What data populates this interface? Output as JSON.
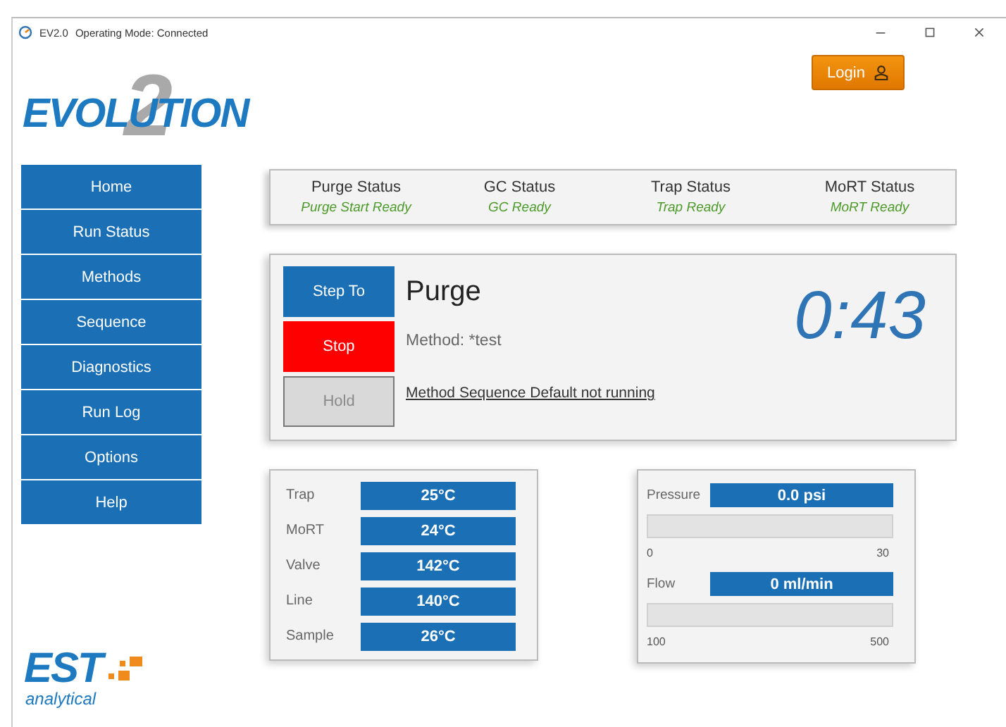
{
  "window": {
    "app": "EV2.0",
    "title": "Operating Mode: Connected"
  },
  "logo": {
    "word": "EVOLUTION",
    "numeral": "2"
  },
  "login": {
    "label": "Login"
  },
  "sidebar": {
    "items": [
      {
        "label": "Home",
        "selected": false
      },
      {
        "label": "Run Status",
        "selected": false
      },
      {
        "label": "Methods",
        "selected": false
      },
      {
        "label": "Sequence",
        "selected": false
      },
      {
        "label": "Diagnostics",
        "selected": false
      },
      {
        "label": "Run Log",
        "selected": false
      },
      {
        "label": "Options",
        "selected": false
      },
      {
        "label": "Help",
        "selected": false
      }
    ]
  },
  "statuses": [
    {
      "name": "Purge Status",
      "value": "Purge Start Ready"
    },
    {
      "name": "GC Status",
      "value": "GC Ready"
    },
    {
      "name": "Trap Status",
      "value": "Trap Ready"
    },
    {
      "name": "MoRT Status",
      "value": "MoRT Ready"
    }
  ],
  "run": {
    "buttons": [
      {
        "label": "Step To",
        "kind": "primary",
        "disabled": false
      },
      {
        "label": "Stop",
        "kind": "danger",
        "disabled": false
      },
      {
        "label": "Hold",
        "kind": "neutral",
        "disabled": true
      }
    ],
    "step": "Purge",
    "method": "Method: *test",
    "sequence_link": "Method Sequence Default not running",
    "timer": "0:43"
  },
  "temperatures": [
    {
      "name": "Trap",
      "value": "25°C"
    },
    {
      "name": "MoRT",
      "value": "24°C"
    },
    {
      "name": "Valve",
      "value": "142°C"
    },
    {
      "name": "Line",
      "value": "140°C"
    },
    {
      "name": "Sample",
      "value": "26°C"
    }
  ],
  "gauges": [
    {
      "name": "Pressure",
      "value": "0.0 psi",
      "min": "0",
      "max": "30"
    },
    {
      "name": "Flow",
      "value": "0 ml/min",
      "min": "100",
      "max": "500"
    }
  ],
  "brand": {
    "name": "EST",
    "tagline": "analytical"
  }
}
